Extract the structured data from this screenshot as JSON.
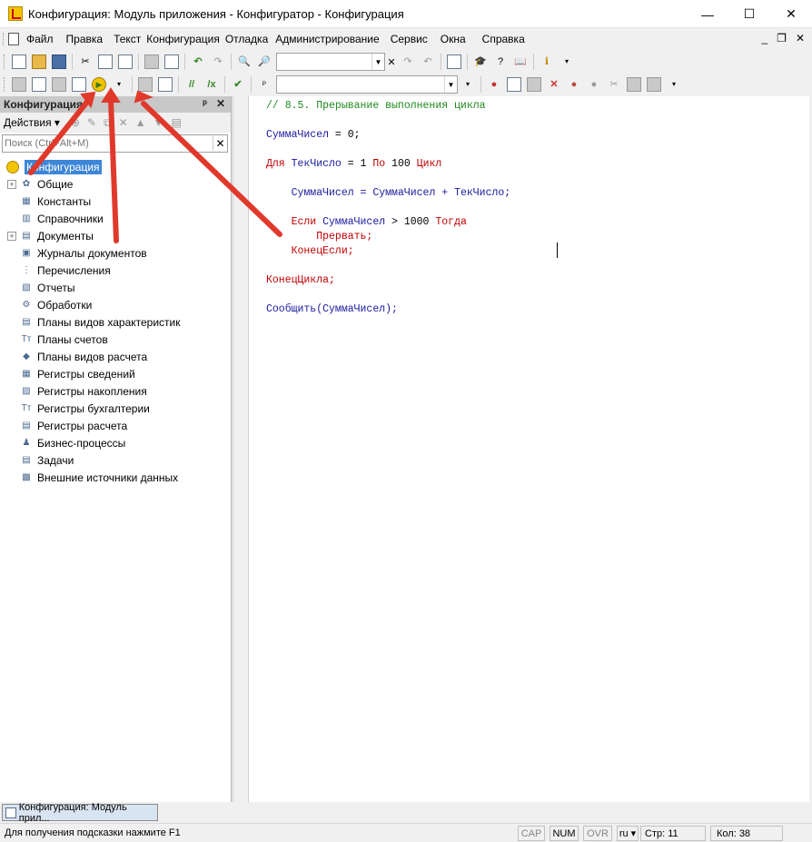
{
  "window": {
    "title": "Конфигурация: Модуль приложения - Конфигуратор - Конфигурация",
    "minimize": "—",
    "maximize": "☐",
    "close": "✕"
  },
  "menubar": {
    "items": [
      "Файл",
      "Правка",
      "Текст",
      "Конфигурация",
      "Отладка",
      "Администрирование",
      "Сервис",
      "Окна",
      "Справка"
    ],
    "mdi_minimize": "_",
    "mdi_restore": "❐",
    "mdi_close": "✕"
  },
  "left_panel": {
    "title": "Конфигурация",
    "pin": "ᵖ",
    "close": "✕",
    "actions_label": "Действия ▾",
    "search_placeholder": "Поиск (Ctrl+Alt+M)",
    "search_clear": "✕",
    "tree_root": "Конфигурация",
    "tree_items": [
      {
        "label": "Общие",
        "expandable": true,
        "icon": "common-icon"
      },
      {
        "label": "Константы",
        "expandable": false,
        "icon": "constants-icon"
      },
      {
        "label": "Справочники",
        "expandable": false,
        "icon": "catalogs-icon"
      },
      {
        "label": "Документы",
        "expandable": true,
        "icon": "documents-icon"
      },
      {
        "label": "Журналы документов",
        "expandable": false,
        "icon": "journals-icon"
      },
      {
        "label": "Перечисления",
        "expandable": false,
        "icon": "enums-icon"
      },
      {
        "label": "Отчеты",
        "expandable": false,
        "icon": "reports-icon"
      },
      {
        "label": "Обработки",
        "expandable": false,
        "icon": "processing-icon"
      },
      {
        "label": "Планы видов характеристик",
        "expandable": false,
        "icon": "chart-of-characteristics-icon"
      },
      {
        "label": "Планы счетов",
        "expandable": false,
        "icon": "chart-of-accounts-icon"
      },
      {
        "label": "Планы видов расчета",
        "expandable": false,
        "icon": "chart-of-calculation-icon"
      },
      {
        "label": "Регистры сведений",
        "expandable": false,
        "icon": "info-registers-icon"
      },
      {
        "label": "Регистры накопления",
        "expandable": false,
        "icon": "accumulation-registers-icon"
      },
      {
        "label": "Регистры бухгалтерии",
        "expandable": false,
        "icon": "accounting-registers-icon"
      },
      {
        "label": "Регистры расчета",
        "expandable": false,
        "icon": "calculation-registers-icon"
      },
      {
        "label": "Бизнес-процессы",
        "expandable": false,
        "icon": "business-processes-icon"
      },
      {
        "label": "Задачи",
        "expandable": false,
        "icon": "tasks-icon"
      },
      {
        "label": "Внешние источники данных",
        "expandable": false,
        "icon": "external-data-sources-icon"
      }
    ]
  },
  "editor": {
    "lines": {
      "l1": "// 8.5. Прерывание выполнения цикла",
      "l3_ident": "СуммаЧисел",
      "l3_rest": " = 0;",
      "l5_kw1": "Для",
      "l5_ident": " ТекЧисло",
      "l5_eq": " = 1 ",
      "l5_kw2": "По",
      "l5_num": " 100 ",
      "l5_kw3": "Цикл",
      "l7_ident1": "    СуммаЧисел",
      "l7_eq": " = ",
      "l7_ident2": "СуммаЧисел",
      "l7_plus": " + ",
      "l7_ident3": "ТекЧисло",
      "l7_end": ";",
      "l9_kw1": "    Если",
      "l9_ident": " СуммаЧисел",
      "l9_gt": " > 1000 ",
      "l9_kw2": "Тогда",
      "l10_kw": "        Прервать",
      "l10_end": ";",
      "l11_kw": "    КонецЕсли",
      "l11_end": ";",
      "l13_kw": "КонецЦикла",
      "l13_end": ";",
      "l15_ident": "Сообщить(СуммаЧисел);"
    }
  },
  "bottom": {
    "window_tab": "Конфигурация: Модуль прил...",
    "status_hint": "Для получения подсказки нажмите F1",
    "cap": "CAP",
    "num": "NUM",
    "ovr": "OVR",
    "lang": "ru ▾",
    "line": "Стр: 11",
    "col": "Кол: 38"
  },
  "colors": {
    "comment": "#1e8a1e",
    "identifier": "#1a1a9e",
    "keyword": "#c00000",
    "arrow": "#e0392b",
    "selection": "#3d86d8"
  }
}
